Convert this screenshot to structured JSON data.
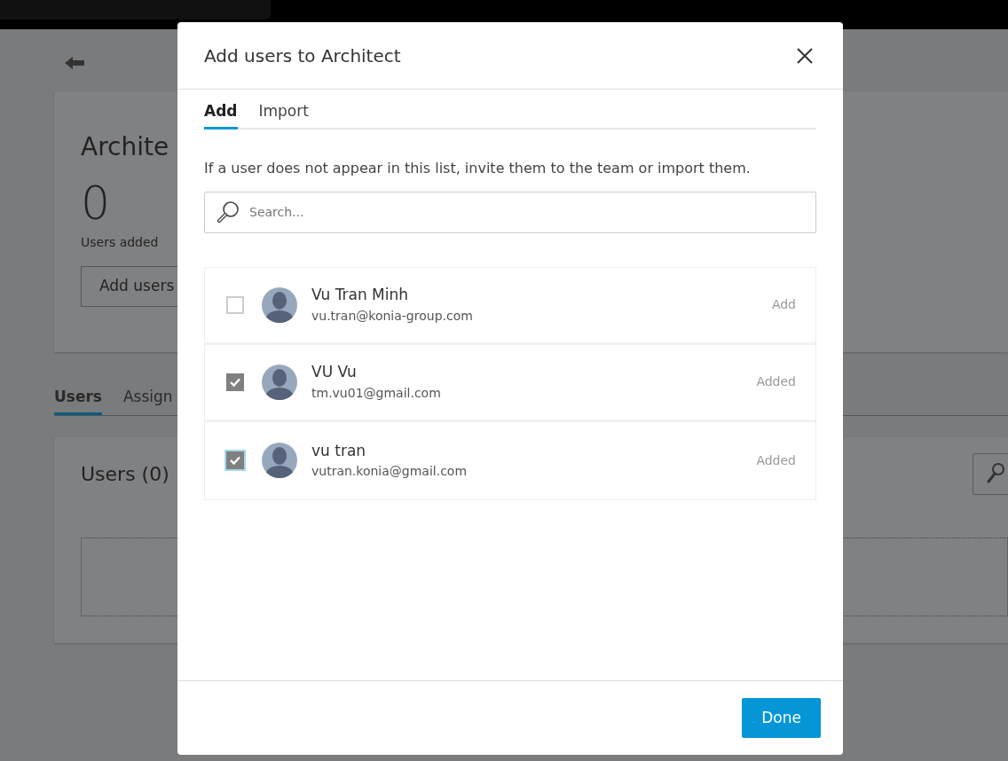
{
  "page": {
    "title": "Archite",
    "count": "0",
    "count_label": "Users added",
    "add_button": "Add users",
    "tabs": [
      {
        "label": "Users",
        "selected": true
      },
      {
        "label": "Assign",
        "selected": false
      }
    ],
    "users_heading": "Users (0)"
  },
  "dialog": {
    "title": "Add users to Architect",
    "tabs": [
      {
        "label": "Add",
        "selected": true
      },
      {
        "label": "Import",
        "selected": false
      }
    ],
    "description": "If a user does not appear in this list, invite them to the team or import them.",
    "search": {
      "placeholder": "Search..."
    },
    "users": [
      {
        "name": "Vu Tran Minh",
        "email": "vu.tran@konia-group.com",
        "checked": false,
        "focused": false,
        "status": "Add"
      },
      {
        "name": "VU Vu",
        "email": "tm.vu01@gmail.com",
        "checked": true,
        "focused": false,
        "status": "Added"
      },
      {
        "name": "vu tran",
        "email": "vutran.konia@gmail.com",
        "checked": true,
        "focused": true,
        "status": "Added"
      }
    ],
    "done_button": "Done"
  }
}
